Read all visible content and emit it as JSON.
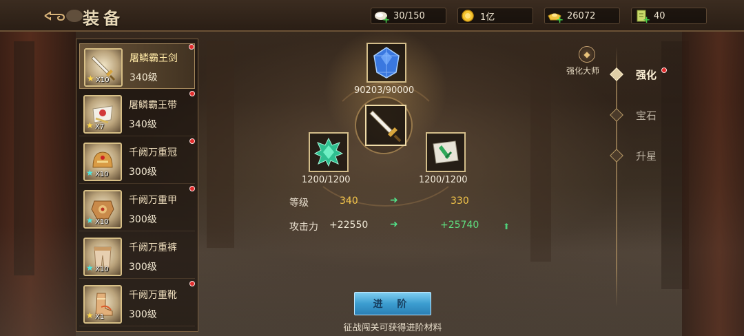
{
  "header": {
    "back_icon": "cloud-swirl-back-icon",
    "title": "装备"
  },
  "resources": [
    {
      "icon": "stamina-icon",
      "value": "30/150"
    },
    {
      "icon": "gold-coin-icon",
      "value": "1亿"
    },
    {
      "icon": "ingot-icon",
      "value": "26072"
    },
    {
      "icon": "ticket-icon",
      "value": "40"
    }
  ],
  "equipment": [
    {
      "name": "屠鳞霸王剑",
      "level": "340级",
      "multiplier": "X10",
      "star": "gold",
      "selected": true,
      "red_dot": true
    },
    {
      "name": "屠鳞霸王带",
      "level": "340级",
      "multiplier": "X7",
      "star": "gold",
      "selected": false,
      "red_dot": true
    },
    {
      "name": "千阙万重冠",
      "level": "300级",
      "multiplier": "X10",
      "star": "cyan",
      "selected": false,
      "red_dot": true
    },
    {
      "name": "千阙万重甲",
      "level": "300级",
      "multiplier": "X10",
      "star": "cyan",
      "selected": false,
      "red_dot": true
    },
    {
      "name": "千阙万重裤",
      "level": "300级",
      "multiplier": "X10",
      "star": "cyan",
      "selected": false,
      "red_dot": false
    },
    {
      "name": "千阙万重靴",
      "level": "300级",
      "multiplier": "X1",
      "star": "gold",
      "selected": false,
      "red_dot": true
    }
  ],
  "materials": {
    "top": {
      "icon": "blue-crystal-icon",
      "count": "90203/90000"
    },
    "left": {
      "icon": "green-gem-icon",
      "count": "1200/1200"
    },
    "right": {
      "icon": "green-scroll-icon",
      "count": "1200/1200"
    },
    "center": {
      "icon": "sword-icon"
    }
  },
  "stats": {
    "level_label": "等级",
    "level_current": "340",
    "level_next": "330",
    "attack_label": "攻击力",
    "attack_current": "+22550",
    "attack_next": "+25740"
  },
  "advance_button": "进 阶",
  "hint": "征战闯关可获得进阶材料",
  "tabs": {
    "master_label": "强化大师",
    "items": [
      {
        "label": "强化",
        "active": true,
        "red_dot": true
      },
      {
        "label": "宝石",
        "active": false,
        "red_dot": false
      },
      {
        "label": "升星",
        "active": false,
        "red_dot": false
      }
    ]
  },
  "colors": {
    "accent_gold": "#f2c44a",
    "up_green": "#5fe080",
    "button_blue": "#3c9dd0",
    "red_dot": "#e22b2b"
  }
}
